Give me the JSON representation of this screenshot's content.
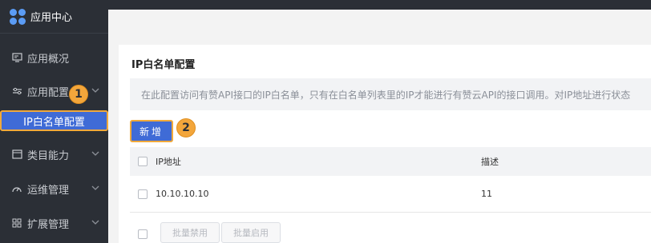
{
  "sidebar": {
    "brand": "应用中心",
    "items": [
      {
        "label": "应用概况",
        "icon": "monitor-icon"
      },
      {
        "label": "应用配置",
        "icon": "sliders-icon",
        "expanded": true
      },
      {
        "label": "IP白名单配置",
        "active": true
      },
      {
        "label": "类目能力",
        "icon": "window-icon"
      },
      {
        "label": "运维管理",
        "icon": "gauge-icon"
      },
      {
        "label": "扩展管理",
        "icon": "grid-icon"
      }
    ]
  },
  "steps": {
    "one": "1",
    "two": "2"
  },
  "panel": {
    "title": "IP白名单配置",
    "notice": "在此配置访问有赞API接口的IP白名单，只有在白名单列表里的IP才能进行有赞云API的接口调用。对IP地址进行状态",
    "add_button": "新增",
    "table": {
      "headers": {
        "ip": "IP地址",
        "desc": "描述"
      },
      "rows": [
        {
          "ip": "10.10.10.10",
          "desc": "11"
        }
      ]
    },
    "footer": {
      "batch_disable": "批量禁用",
      "batch_enable": "批量启用"
    }
  },
  "colors": {
    "sidebar_bg": "#2b2f36",
    "accent": "#3f6bd6",
    "highlight": "#f3a63b"
  }
}
